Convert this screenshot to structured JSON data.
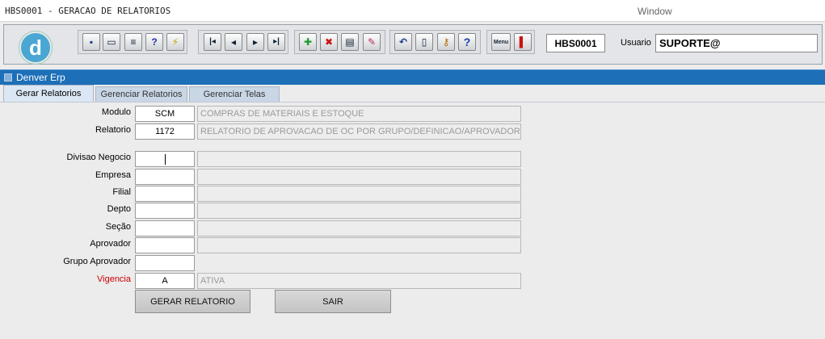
{
  "window": {
    "title": "HBS0001 - GERACAO DE RELATORIOS",
    "menu_label": "Window"
  },
  "toolbar": {
    "logo_letter": "d",
    "form_code": "HBS0001",
    "user_label": "Usuario",
    "user_value": "SUPORTE@",
    "icons": [
      "save-icon",
      "print-preview-icon",
      "print-icon",
      "query-help-icon",
      "execute-query-icon",
      "first-record-icon",
      "previous-record-icon",
      "next-record-icon",
      "last-record-icon",
      "insert-record-icon",
      "delete-record-icon",
      "list-values-icon",
      "edit-icon",
      "undo-icon",
      "clipboard-icon",
      "key-icon",
      "help-icon",
      "menu-icon",
      "exit-icon"
    ],
    "button_glyphs": {
      "save": "▪",
      "preview": "▭",
      "print": "≡",
      "query": "?",
      "execute": "⚡",
      "first": "|◂",
      "prev": "◂",
      "next": "▸",
      "last": "▸|",
      "insert": "✚",
      "delete": "✖",
      "lov": "▤",
      "edit": "✎",
      "undo": "↶",
      "clipboard": "▯",
      "key": "⚷",
      "help": "?",
      "menu": "Menu",
      "exit": "▌"
    }
  },
  "inner_window": {
    "caption": "Denver Erp",
    "tabs": [
      {
        "label": "Gerar Relatorios",
        "active": true
      },
      {
        "label": "Gerenciar Relatorios",
        "active": false
      },
      {
        "label": "Gerenciar Telas",
        "active": false
      }
    ]
  },
  "form": {
    "modulo": {
      "label": "Modulo",
      "code": "SCM",
      "desc": "COMPRAS DE MATERIAIS E ESTOQUE"
    },
    "relatorio": {
      "label": "Relatorio",
      "code": "1172",
      "desc": "RELATORIO DE APROVACAO DE OC POR GRUPO/DEFINICAO/APROVADOR"
    },
    "divisao": {
      "label": "Divisao Negocio",
      "code": "",
      "desc": ""
    },
    "empresa": {
      "label": "Empresa",
      "code": "",
      "desc": ""
    },
    "filial": {
      "label": "Filial",
      "code": "",
      "desc": ""
    },
    "depto": {
      "label": "Depto",
      "code": "",
      "desc": ""
    },
    "secao": {
      "label": "Seção",
      "code": "",
      "desc": ""
    },
    "aprovador": {
      "label": "Aprovador",
      "code": "",
      "desc": ""
    },
    "grupo_aprovador": {
      "label": "Grupo Aprovador",
      "code": ""
    },
    "vigencia": {
      "label": "Vigencia",
      "code": "A",
      "desc": "ATIVA",
      "label_color": "#cc0000"
    }
  },
  "actions": {
    "generate_label": "GERAR RELATORIO",
    "exit_label": "SAIR"
  },
  "colors": {
    "header_blue": "#1d6fb8",
    "logo_blue": "#4aa6d3",
    "tab_active": "#dbe7f4",
    "tab_inactive": "#c9d6e6"
  }
}
